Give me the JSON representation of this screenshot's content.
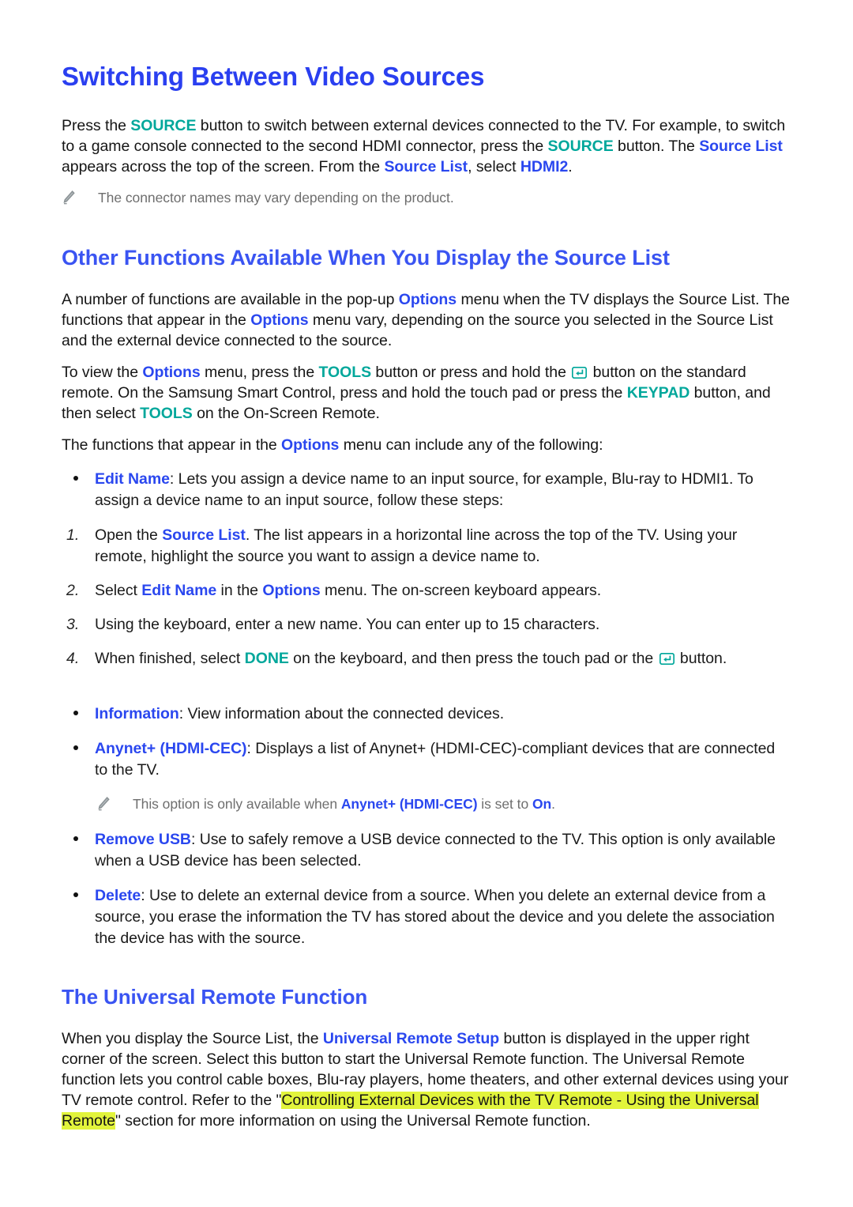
{
  "colors": {
    "heading_blue": "#2a3ff0",
    "keyword_blue": "#2a47ef",
    "keyword_teal": "#00a79b",
    "highlight_yellow_green": "#e2f43c",
    "note_gray": "#6e6e6e"
  },
  "sections": {
    "switching": {
      "title": "Switching Between Video Sources",
      "paragraph": {
        "p1": "Press the ",
        "kw_source_1": "SOURCE",
        "p2": " button to switch between external devices connected to the TV. For example, to switch to a game console connected to the second HDMI connector, press the ",
        "kw_source_2": "SOURCE",
        "p3": " button. The ",
        "kw_source_list_1": "Source List",
        "p4": " appears across the top of the screen. From the ",
        "kw_source_list_2": "Source List",
        "p5": ", select ",
        "kw_hdmi2": "HDMI2",
        "p6": "."
      },
      "note": "The connector names may vary depending on the product."
    },
    "other_functions": {
      "title": "Other Functions Available When You Display the Source List",
      "para1": {
        "t1": "A number of functions are available in the pop-up ",
        "kw1": "Options",
        "t2": " menu when the TV displays the Source List. The functions that appear in the ",
        "kw2": "Options",
        "t3": " menu vary, depending on the source you selected in the Source List and the external device connected to the source."
      },
      "para2": {
        "t1": "To view the ",
        "kw_options": "Options",
        "t2": " menu, press the ",
        "kw_tools_1": "TOOLS",
        "t3": " button or press and hold the ",
        "icon": "enter-key-icon",
        "t4": " button on the standard remote. On the Samsung Smart Control, press and hold the touch pad or press the ",
        "kw_keypad": "KEYPAD",
        "t5": " button, and then select ",
        "kw_tools_2": "TOOLS",
        "t6": " on the On-Screen Remote."
      },
      "para3": {
        "t1": "The functions that appear in the ",
        "kw": "Options",
        "t2": " menu can include any of the following:"
      },
      "bullet_edit_name": {
        "label": "Edit Name",
        "text": ": Lets you assign a device name to an input source, for example, Blu-ray to HDMI1. To assign a device name to an input source, follow these steps:"
      },
      "steps": [
        {
          "num": "1.",
          "t1": "Open the ",
          "kw": "Source List",
          "t2": ". The list appears in a horizontal line across the top of the TV. Using your remote, highlight the source you want to assign a device name to."
        },
        {
          "num": "2.",
          "t1": "Select ",
          "kw": "Edit Name",
          "t2": " in the ",
          "kw2": "Options",
          "t3": " menu. The on-screen keyboard appears."
        },
        {
          "num": "3.",
          "t1": "Using the keyboard, enter a new name. You can enter up to 15 characters."
        },
        {
          "num": "4.",
          "t1": "When finished, select ",
          "kw_done": "DONE",
          "t2": " on the keyboard, and then press the touch pad or the ",
          "icon": "enter-key-icon",
          "t3": " button."
        }
      ],
      "bullet_information": {
        "label": "Information",
        "text": ": View information about the connected devices."
      },
      "bullet_anynet": {
        "label": "Anynet+ (HDMI-CEC)",
        "text": ": Displays a list of Anynet+ (HDMI-CEC)-compliant devices that are connected to the TV.",
        "note": {
          "t1": "This option is only available when ",
          "kw1": "Anynet+ (HDMI-CEC)",
          "t2": " is set to ",
          "kw2": "On",
          "t3": "."
        }
      },
      "bullet_remove_usb": {
        "label": "Remove USB",
        "text": ": Use to safely remove a USB device connected to the TV. This option is only available when a USB device has been selected."
      },
      "bullet_delete": {
        "label": "Delete",
        "text": ": Use to delete an external device from a source. When you delete an external device from a source, you erase the information the TV has stored about the device and you delete the association the device has with the source."
      }
    },
    "universal_remote": {
      "title": "The Universal Remote Function",
      "para": {
        "t1": "When you display the Source List, the ",
        "kw": "Universal Remote Setup",
        "t2": " button is displayed in the upper right corner of the screen. Select this button to start the Universal Remote function. The Universal Remote function lets you control cable boxes, Blu-ray players, home theaters, and other external devices using your TV remote control. Refer to the \"",
        "highlight": "Controlling External Devices with the TV Remote - Using the Universal Remote",
        "t3": "\" section for more information on using the Universal Remote function."
      }
    }
  }
}
